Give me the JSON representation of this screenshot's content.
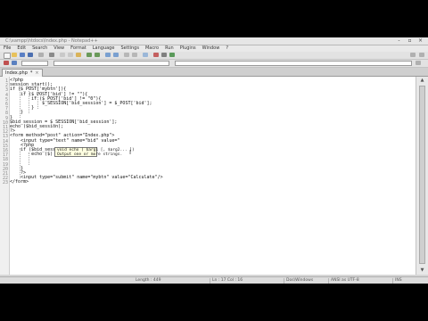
{
  "window": {
    "title": "C:\\xampp\\htdocs\\Index.php - Notepad++",
    "buttons": [
      "-",
      "▫",
      "×"
    ]
  },
  "menubar": [
    "File",
    "Edit",
    "Search",
    "View",
    "Format",
    "Language",
    "Settings",
    "Macro",
    "Run",
    "Plugins",
    "Window",
    "?"
  ],
  "tab": {
    "label": "Index.php",
    "modified_mark": "*",
    "close": "×"
  },
  "code_lines": [
    "<?php",
    "session_start();",
    "if ($_POST['mybtn']){",
    "    if ($_POST['bid'] != \"\"){",
    "        if ($_POST['bid'] != \"0\"){",
    "            $_SESSION['bid_session'] = $_POST['bid'];",
    "        }",
    "    }",
    "}",
    "$bid_session = $_SESSION['bid_session'];",
    "echo ($bid_session);",
    "?>",
    "<form method=\"post\" action=\"Index.php\">",
    "    <input type=\"text\" name=\"bid\" value=\"",
    "    <?php",
    "    if ($bid_session == \"\"){",
    "        echo ($)",
    "",
    "",
    "    }",
    "    ?>",
    "    <input type=\"submit\" name=\"mybtn\" value=\"Calculate\"/>",
    "</form>"
  ],
  "tooltip": {
    "line1": "void echo ( $arg1 [, $arg2... ])",
    "line2": "Output one or more strings."
  },
  "status": {
    "length": "Length : 449",
    "position": "Ln : 17  Col : 16",
    "eol": "Dos\\Windows",
    "encoding": "ANSI as UTF-8",
    "mode": "INS"
  },
  "colors": {
    "window_bg": "#d6d6d6",
    "editor_bg": "#ffffff",
    "tooltip_bg": "#ffffe1",
    "letterbox": "#000000"
  }
}
